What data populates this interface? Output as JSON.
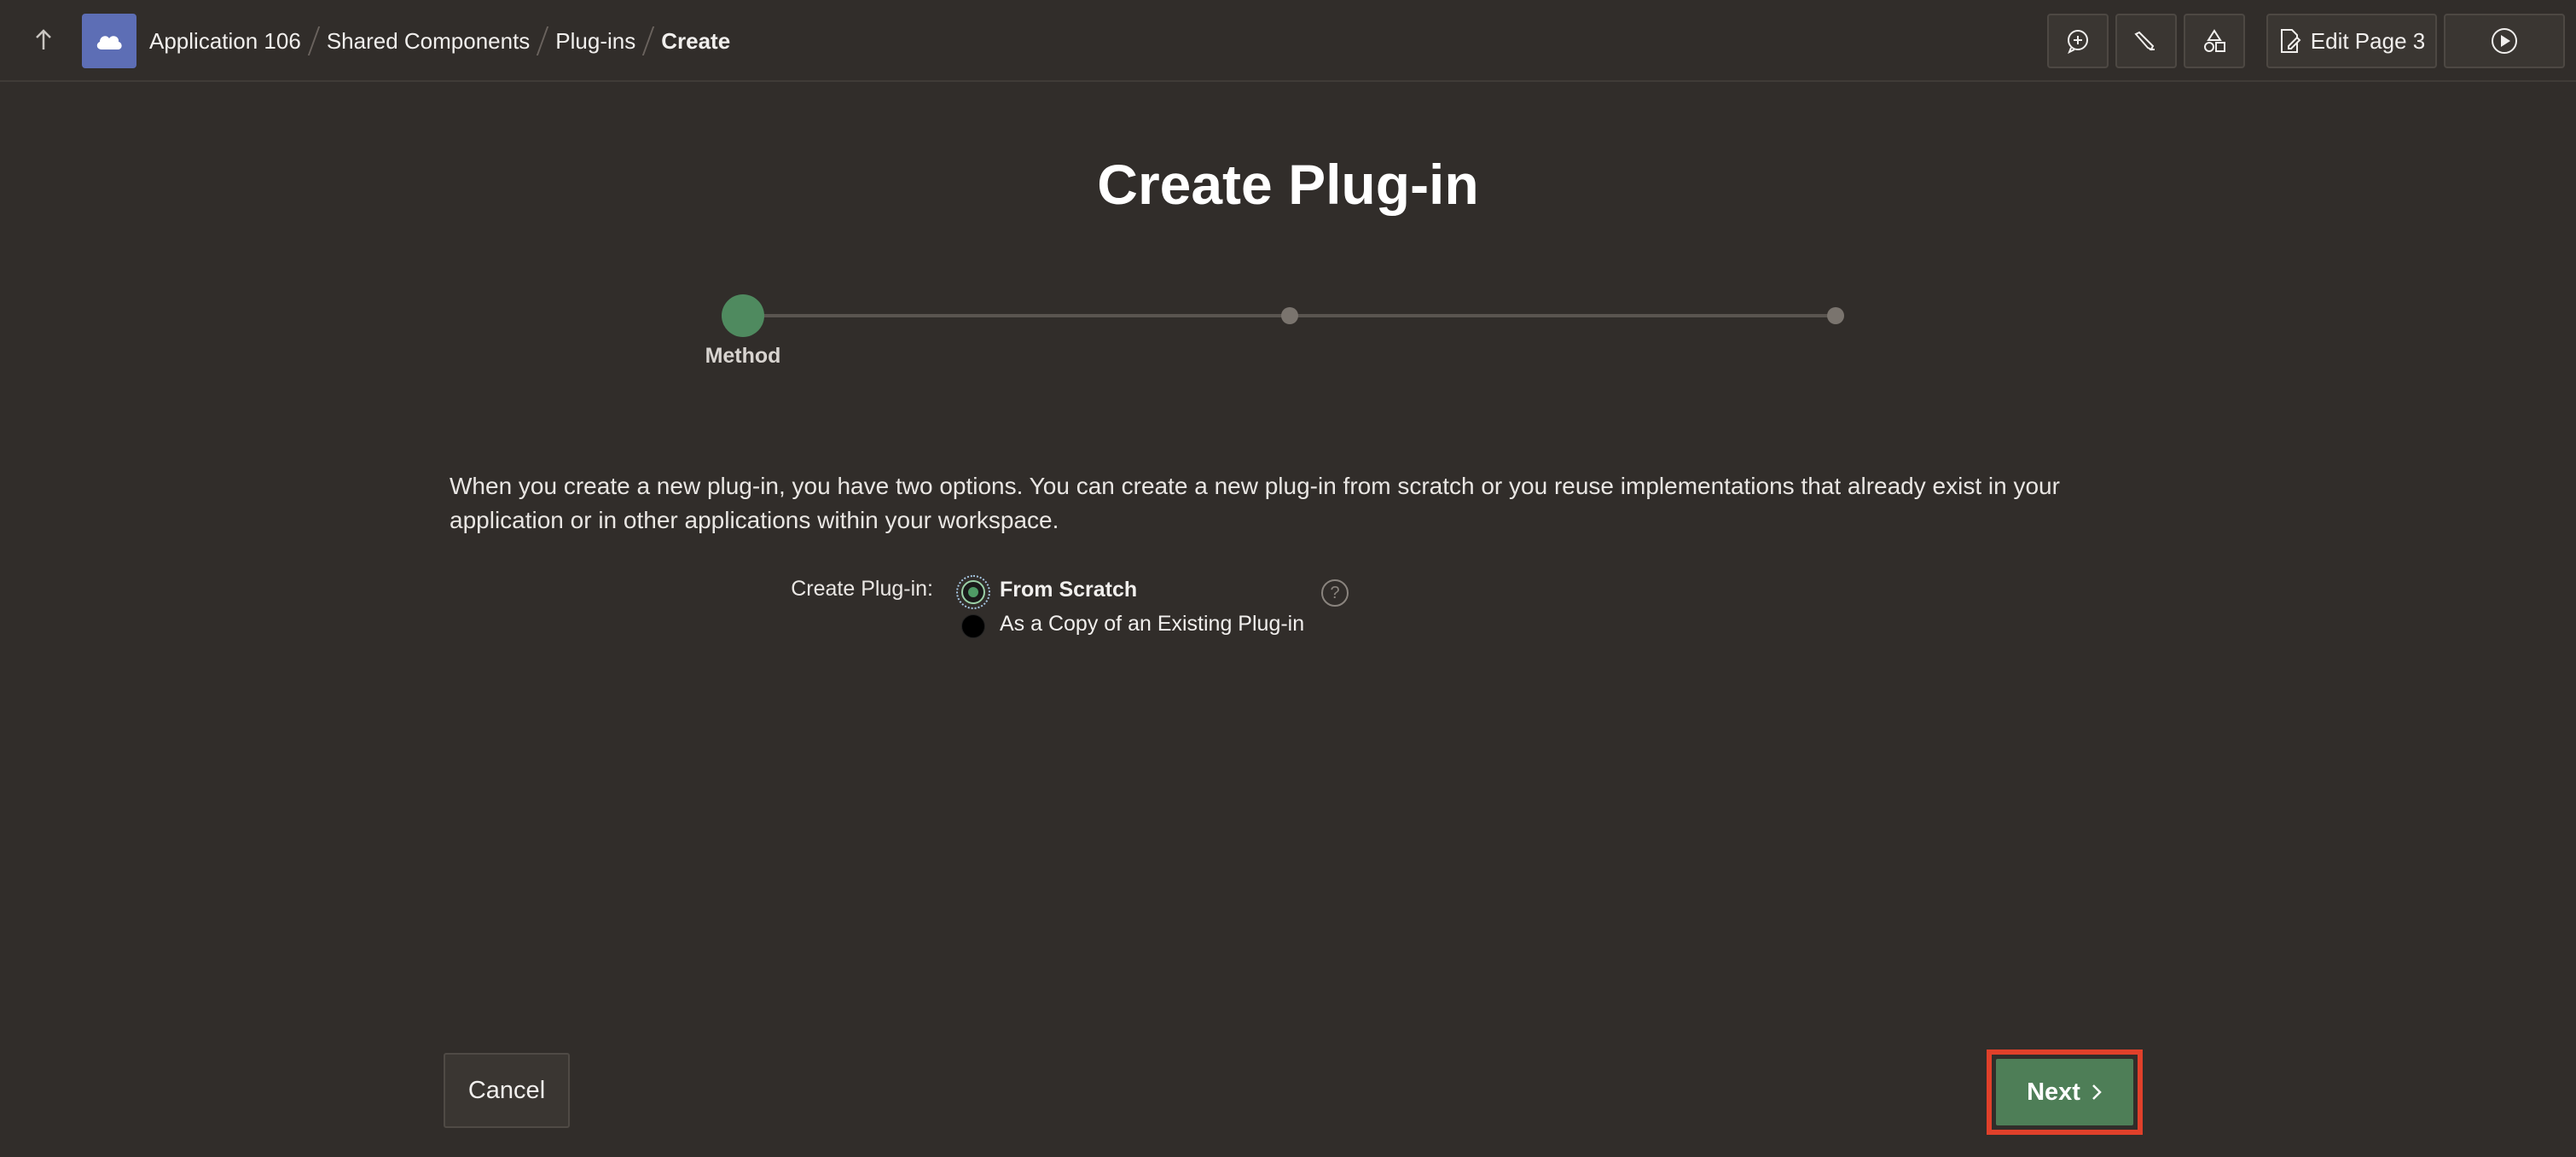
{
  "breadcrumb": {
    "items": [
      {
        "label": "Application 106"
      },
      {
        "label": "Shared Components"
      },
      {
        "label": "Plug-ins"
      },
      {
        "label": "Create"
      }
    ]
  },
  "toolbar": {
    "edit_page_label": "Edit Page 3"
  },
  "page": {
    "title": "Create Plug-in",
    "steps": [
      {
        "label": "Method",
        "active": true
      },
      {
        "label": "",
        "active": false
      },
      {
        "label": "",
        "active": false
      }
    ],
    "description": "When you create a new plug-in, you have two options. You can create a new plug-in from scratch or you reuse implementations that already exist in your application or in other applications within your workspace.",
    "field_label": "Create Plug-in:",
    "options": [
      {
        "label": "From Scratch",
        "selected": true
      },
      {
        "label": "As a Copy of an Existing Plug-in",
        "selected": false
      }
    ],
    "help_glyph": "?"
  },
  "footer": {
    "cancel_label": "Cancel",
    "next_label": "Next"
  },
  "colors": {
    "background": "#312d2a",
    "accent_green": "#4e7e57",
    "highlight_red": "#e0402a",
    "app_logo": "#5d6eb5"
  },
  "icons": {
    "up": "arrow-up-icon",
    "logo": "cloud-icon",
    "comment": "comment-add-icon",
    "debug": "pencil-icon",
    "shapes": "shapes-icon",
    "edit": "page-edit-icon",
    "run": "play-icon",
    "next": "chevron-right-icon"
  }
}
